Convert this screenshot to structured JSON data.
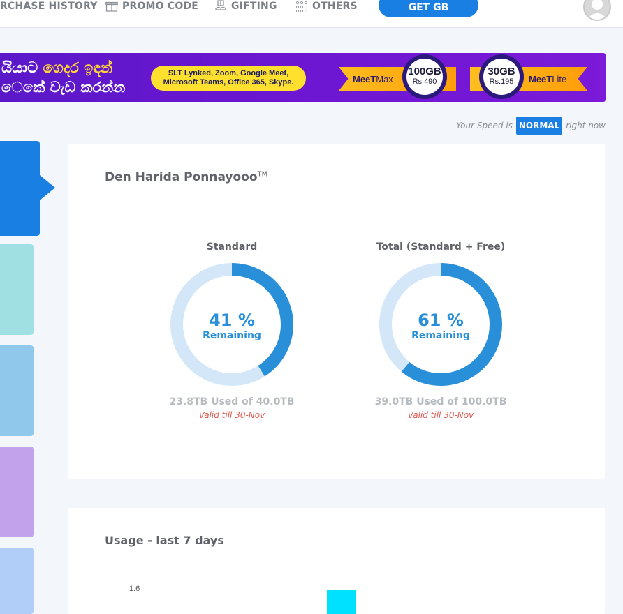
{
  "nav": {
    "items": [
      {
        "label": "RCHASE HISTORY",
        "icon": "none"
      },
      {
        "label": "PROMO CODE",
        "icon": "gift-box-icon"
      },
      {
        "label": "GIFTING",
        "icon": "gift-hand-icon"
      },
      {
        "label": "OTHERS",
        "icon": "dots-grid-icon"
      }
    ],
    "cta_label": "GET GB"
  },
  "banner": {
    "line1_white": "යියාට ",
    "line1_yellow": "ගෙදර ඉඳන්",
    "line2": "ෙකේ වැඩ කරන්න",
    "pill_line1": "SLT Lynked, Zoom, Google Meet,",
    "pill_line2": "Microsoft Teams, Office 365, Skype.",
    "offers": [
      {
        "name_bold": "MeeT",
        "name_light": " Max",
        "gb": "100GB",
        "price": "Rs.490"
      },
      {
        "name_bold": "MeeT",
        "name_light": " Lite",
        "gb": "30GB",
        "price": "Rs.195"
      }
    ]
  },
  "speed": {
    "prefix": "Your Speed is",
    "status": "NORMAL",
    "suffix": "right now"
  },
  "summary": {
    "title": "Den Harida Ponnayooo",
    "title_mark": "TM",
    "gauges": [
      {
        "label": "Standard",
        "percent_remaining": 41,
        "percent_text": "41 %",
        "remaining_label": "Remaining",
        "used_text": "23.8TB Used of 40.0TB",
        "valid_text": "Valid till 30-Nov"
      },
      {
        "label": "Total (Standard + Free)",
        "percent_remaining": 61,
        "percent_text": "61 %",
        "remaining_label": "Remaining",
        "used_text": "39.0TB Used of 100.0TB",
        "valid_text": "Valid till 30-Nov"
      }
    ]
  },
  "usage": {
    "title": "Usage - last 7 days",
    "y_tick": "1.6"
  },
  "colors": {
    "accent": "#1a7fe3",
    "gauge_fill": "#2a8fd9",
    "gauge_track": "#d3e7f8",
    "valid_text": "#e05a4e",
    "bar": "#00e1ff",
    "tabs": [
      "#1a7fe3",
      "#a0e0e2",
      "#8fc8ea",
      "#c3a2ec",
      "#b0cef8"
    ]
  }
}
